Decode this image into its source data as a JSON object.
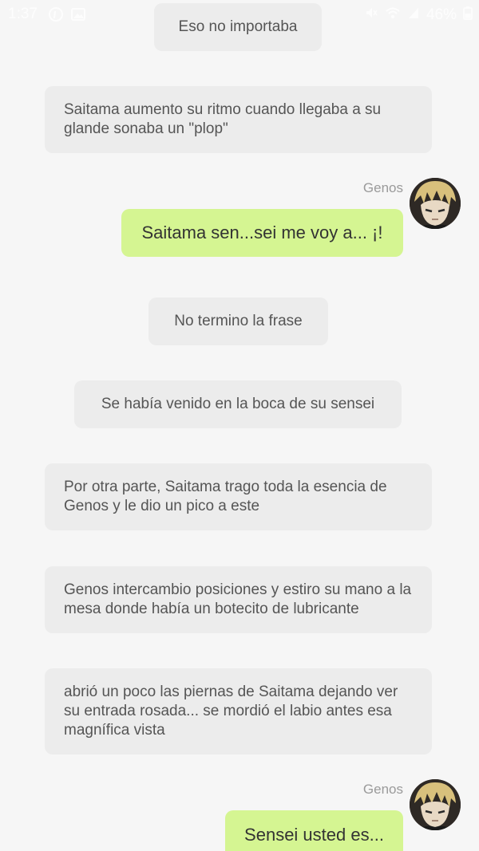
{
  "status_bar": {
    "time": "1:37",
    "battery": "46%",
    "left_icons": [
      "pinterest-icon",
      "image-icon"
    ],
    "right_icons": [
      "mute-icon",
      "wifi-icon",
      "signal-icon",
      "battery-icon"
    ]
  },
  "messages": [
    {
      "type": "narration",
      "text": "Eso no importaba"
    },
    {
      "type": "narration",
      "text": "Saitama aumento su ritmo cuando llegaba a su glande sonaba un \"plop\""
    },
    {
      "type": "speech",
      "speaker": "Genos",
      "text": "Saitama sen...sei me voy a... ¡!"
    },
    {
      "type": "narration",
      "text": "No termino la frase"
    },
    {
      "type": "narration",
      "text": "Se había venido en la boca de su sensei"
    },
    {
      "type": "narration",
      "text": "Por otra parte, Saitama trago toda la esencia de Genos y le dio un pico a este"
    },
    {
      "type": "narration",
      "text": "Genos intercambio posiciones y estiro su mano a la mesa donde había un botecito de lubricante"
    },
    {
      "type": "narration",
      "text": "abrió un poco las piernas de Saitama dejando ver su entrada rosada... se mordió el labio antes esa magnífica vista"
    },
    {
      "type": "speech",
      "speaker": "Genos",
      "text": "Sensei usted es..."
    }
  ],
  "colors": {
    "background": "#f6f6f6",
    "narration_bg": "#ececec",
    "speech_bubble": "#d5f592"
  }
}
